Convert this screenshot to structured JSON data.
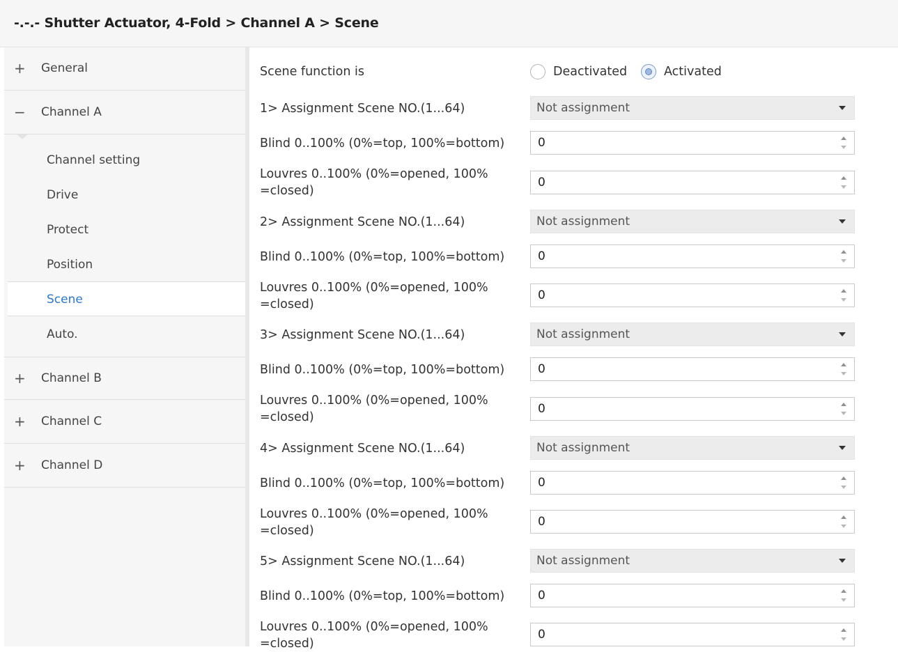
{
  "breadcrumb": "-.-.- Shutter Actuator, 4-Fold > Channel A > Scene",
  "sidebar": {
    "general": {
      "sign": "+",
      "label": "General"
    },
    "channel_a": {
      "sign": "−",
      "label": "Channel A"
    },
    "channel_a_items": [
      "Channel setting",
      "Drive",
      "Protect",
      "Position",
      "Scene",
      "Auto."
    ],
    "active_item": "Scene",
    "channel_b": {
      "sign": "+",
      "label": "Channel B"
    },
    "channel_c": {
      "sign": "+",
      "label": "Channel C"
    },
    "channel_d": {
      "sign": "+",
      "label": "Channel D"
    }
  },
  "colors": {
    "accent": "#2f77c7",
    "panel": "#f6f6f6"
  },
  "scene_function": {
    "label": "Scene function is",
    "options": [
      "Deactivated",
      "Activated"
    ],
    "selected": "Activated"
  },
  "scenes": [
    {
      "assign_label": "1> Assignment Scene NO.(1...64)",
      "assign_value": "Not assignment",
      "blind_label": "Blind 0..100% (0%=top, 100%=bottom)",
      "blind_value": "0",
      "louvres_label_1": "Louvres 0..100% (0%=opened, 100%",
      "louvres_label_2": "=closed)",
      "louvres_value": "0"
    },
    {
      "assign_label": "2> Assignment Scene NO.(1...64)",
      "assign_value": "Not assignment",
      "blind_label": "Blind 0..100% (0%=top, 100%=bottom)",
      "blind_value": "0",
      "louvres_label_1": "Louvres 0..100% (0%=opened, 100%",
      "louvres_label_2": "=closed)",
      "louvres_value": "0"
    },
    {
      "assign_label": "3> Assignment Scene NO.(1...64)",
      "assign_value": "Not assignment",
      "blind_label": "Blind 0..100% (0%=top, 100%=bottom)",
      "blind_value": "0",
      "louvres_label_1": "Louvres 0..100% (0%=opened, 100%",
      "louvres_label_2": "=closed)",
      "louvres_value": "0"
    },
    {
      "assign_label": "4> Assignment Scene NO.(1...64)",
      "assign_value": "Not assignment",
      "blind_label": "Blind 0..100% (0%=top, 100%=bottom)",
      "blind_value": "0",
      "louvres_label_1": "Louvres 0..100% (0%=opened, 100%",
      "louvres_label_2": "=closed)",
      "louvres_value": "0"
    },
    {
      "assign_label": "5> Assignment Scene NO.(1...64)",
      "assign_value": "Not assignment",
      "blind_label": "Blind 0..100% (0%=top, 100%=bottom)",
      "blind_value": "0",
      "louvres_label_1": "Louvres 0..100% (0%=opened, 100%",
      "louvres_label_2": "=closed)",
      "louvres_value": "0"
    }
  ]
}
